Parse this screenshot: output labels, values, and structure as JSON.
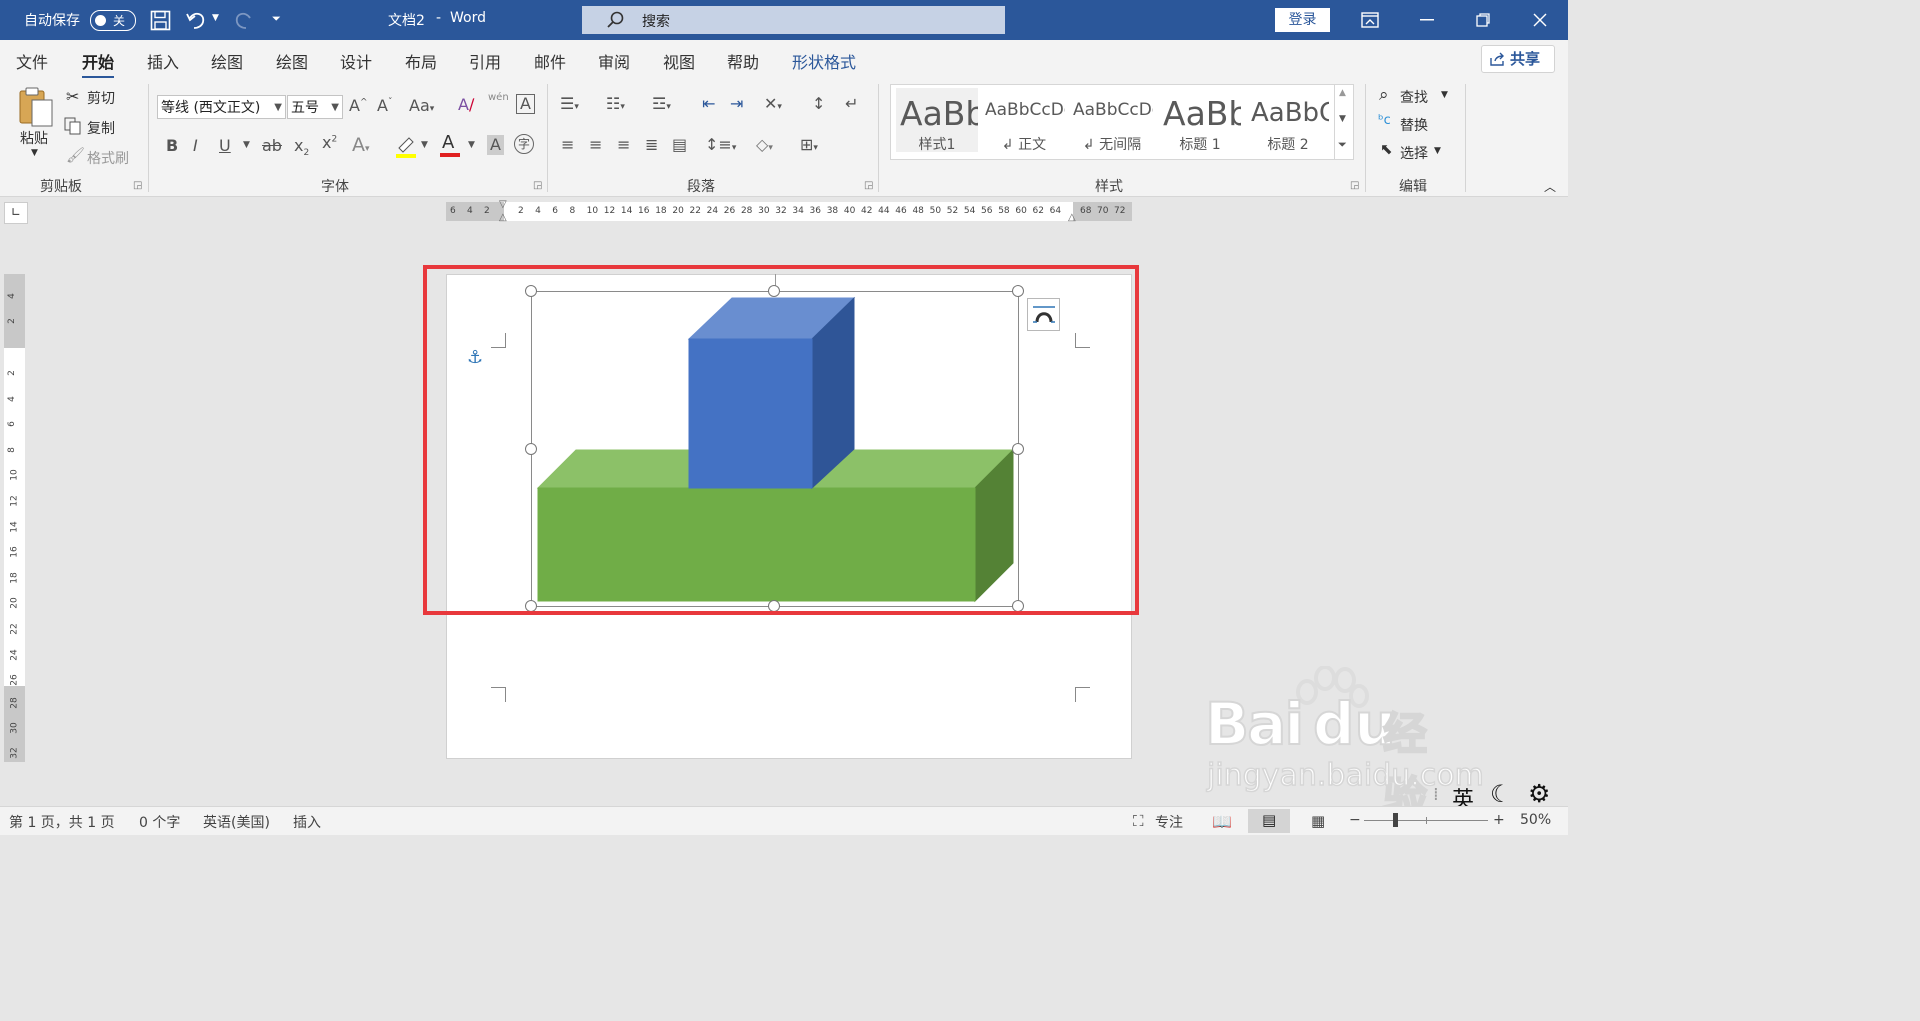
{
  "titlebar": {
    "autosave_label": "自动保存",
    "autosave_state": "关",
    "doc_name": "文档2",
    "separator": "-",
    "app_name": "Word",
    "search_placeholder": "搜索",
    "login_label": "登录"
  },
  "tabs": [
    "文件",
    "开始",
    "插入",
    "绘图",
    "绘图",
    "设计",
    "布局",
    "引用",
    "邮件",
    "审阅",
    "视图",
    "帮助",
    "形状格式"
  ],
  "active_tab": "开始",
  "share_label": "共享",
  "clipboard": {
    "paste": "粘贴",
    "cut": "剪切",
    "copy": "复制",
    "format_painter": "格式刷",
    "group_label": "剪贴板"
  },
  "font": {
    "font_name": "等线 (西文正文)",
    "font_size": "五号",
    "wen": "wén",
    "group_label": "字体"
  },
  "paragraph": {
    "group_label": "段落"
  },
  "styles": {
    "items": [
      {
        "preview": "AaBb",
        "caption": "样式1"
      },
      {
        "preview": "AaBbCcDc",
        "caption": "↲ 正文"
      },
      {
        "preview": "AaBbCcDc",
        "caption": "↲ 无间隔"
      },
      {
        "preview": "AaBb",
        "caption": "标题 1"
      },
      {
        "preview": "AaBbC",
        "caption": "标题 2"
      }
    ],
    "group_label": "样式"
  },
  "editing": {
    "find": "查找",
    "replace": "替换",
    "select": "选择",
    "group_label": "编辑"
  },
  "hruler_left": [
    "6",
    "4",
    "2"
  ],
  "hruler_main": [
    "2",
    "4",
    "6",
    "8",
    "10",
    "12",
    "14",
    "16",
    "18",
    "20",
    "22",
    "24",
    "26",
    "28",
    "30",
    "32",
    "34",
    "36",
    "38",
    "40",
    "42",
    "44",
    "46",
    "48",
    "50",
    "52",
    "54",
    "56",
    "58",
    "60",
    "62",
    "64"
  ],
  "hruler_right": [
    "68",
    "70",
    "72"
  ],
  "vruler_top": [
    "4",
    "2"
  ],
  "vruler_main": [
    "2",
    "4",
    "6",
    "8",
    "10",
    "12",
    "14",
    "16",
    "18",
    "20",
    "22",
    "24",
    "26"
  ],
  "vruler_bottom": [
    "28",
    "30",
    "32"
  ],
  "colors": {
    "title_blue": "#2b579a",
    "highlight_red": "#e8383c",
    "cube_front": "#4472c4",
    "cube_top": "#698ed0",
    "cube_side": "#2f5597",
    "box_front": "#70ad47",
    "box_top": "#8cc168",
    "box_side": "#548235"
  },
  "status": {
    "page": "第 1 页，共 1 页",
    "words": "0 个字",
    "language": "英语(美国)",
    "mode": "插入",
    "focus": "专注",
    "zoom": "50%",
    "ime": "英"
  },
  "watermark": {
    "brand": "Bai",
    "brand2": "du",
    "cn": "经验",
    "url": "jingyan.baidu.com"
  }
}
